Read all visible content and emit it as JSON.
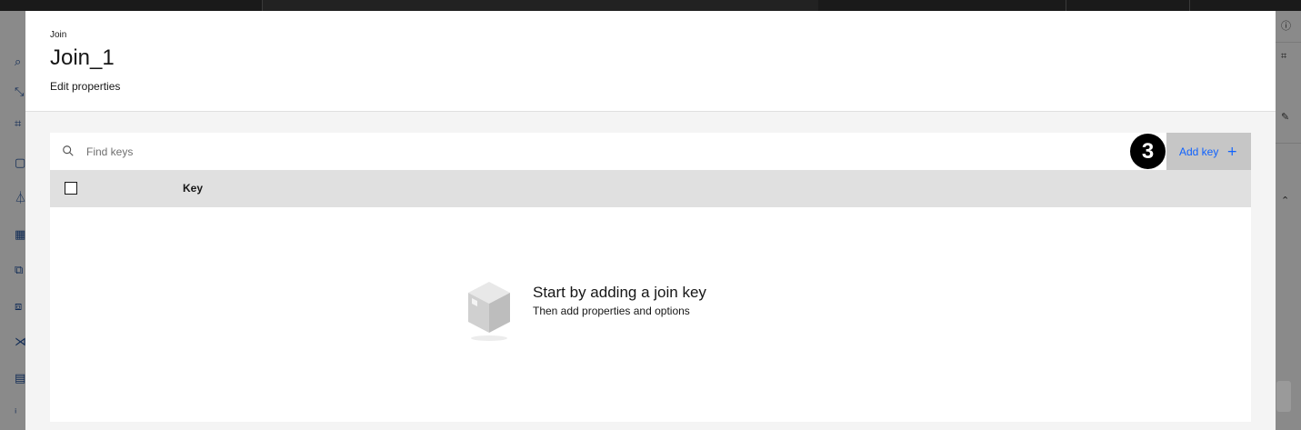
{
  "modal": {
    "eyebrow": "Join",
    "title": "Join_1",
    "subtitle": "Edit properties"
  },
  "toolbar": {
    "search_placeholder": "Find keys",
    "badge_number": "3",
    "add_key_label": "Add key",
    "add_key_icon": "+"
  },
  "table": {
    "columns": [
      "Key"
    ]
  },
  "empty_state": {
    "title": "Start by adding a join key",
    "subtitle": "Then add properties and options"
  },
  "colors": {
    "accent": "#0f62fe",
    "header_bg": "#e0e0e0",
    "button_bg": "#c6c6c6",
    "badge_bg": "#000000"
  }
}
